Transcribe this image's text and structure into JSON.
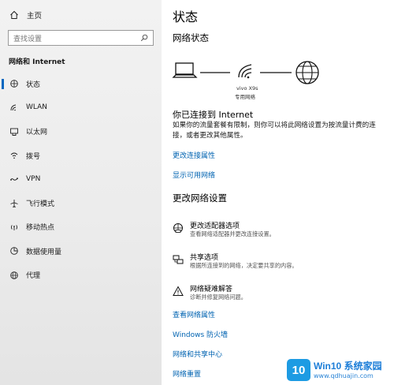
{
  "sidebar": {
    "home_label": "主页",
    "search_placeholder": "查找设置",
    "section_title": "网络和 Internet",
    "items": [
      {
        "label": "状态",
        "icon": "globe-status-icon"
      },
      {
        "label": "WLAN",
        "icon": "wifi-icon"
      },
      {
        "label": "以太网",
        "icon": "ethernet-icon"
      },
      {
        "label": "拨号",
        "icon": "dialup-icon"
      },
      {
        "label": "VPN",
        "icon": "vpn-icon"
      },
      {
        "label": "飞行模式",
        "icon": "airplane-icon"
      },
      {
        "label": "移动热点",
        "icon": "hotspot-icon"
      },
      {
        "label": "数据使用量",
        "icon": "data-usage-icon"
      },
      {
        "label": "代理",
        "icon": "proxy-globe-icon"
      }
    ],
    "active_index": 0
  },
  "main": {
    "title": "状态",
    "network_status_heading": "网络状态",
    "diagram": {
      "network_name": "vivo X9s",
      "network_type": "专用网络"
    },
    "connected_heading": "你已连接到 Internet",
    "connected_desc": "如果你的流量套餐有限制，则你可以将此网络设置为按流量计费的连接，或者更改其他属性。",
    "links_top": [
      "更改连接属性",
      "显示可用网络"
    ],
    "change_heading": "更改网络设置",
    "options": [
      {
        "title": "更改适配器选项",
        "desc": "查看网络适配器并更改连接设置。",
        "icon": "adapter-icon"
      },
      {
        "title": "共享选项",
        "desc": "根据所连接到的网络，决定要共享的内容。",
        "icon": "sharing-icon"
      },
      {
        "title": "网络疑难解答",
        "desc": "诊断并修复网络问题。",
        "icon": "warning-icon"
      }
    ],
    "links_bottom": [
      "查看网络属性",
      "Windows 防火墙",
      "网络和共享中心",
      "网络重置"
    ]
  },
  "watermark": {
    "badge": "10",
    "brand": "Win10 系统家园",
    "url": "www.qdhuajin.com"
  },
  "colors": {
    "accent": "#0067c0",
    "link": "#0063b1",
    "sidebar_bg": "#ececec"
  }
}
